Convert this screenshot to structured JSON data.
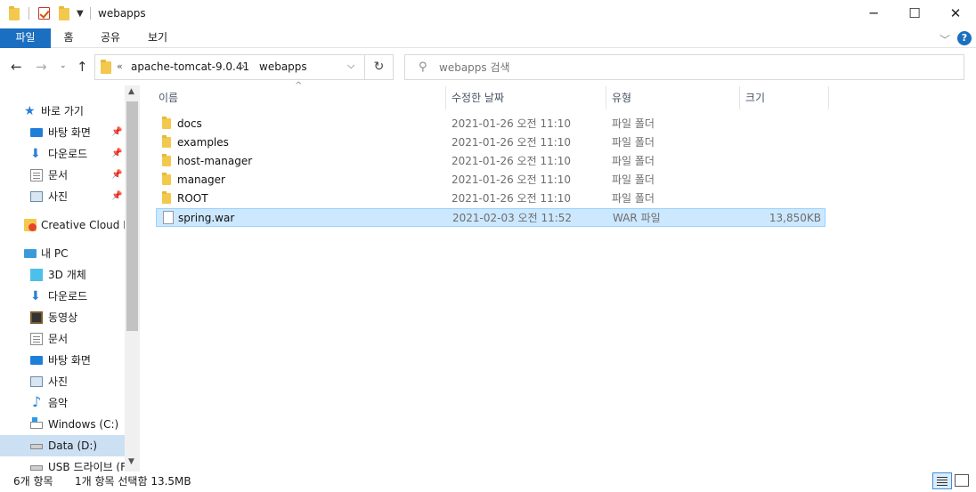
{
  "window": {
    "title": "webapps",
    "minimize": "─",
    "maximize": "☐",
    "close": "✕"
  },
  "ribbon": {
    "tabs": [
      {
        "label": "파일"
      },
      {
        "label": "홈"
      },
      {
        "label": "공유"
      },
      {
        "label": "보기"
      }
    ],
    "help": "?"
  },
  "address": {
    "overflow": "«",
    "crumbs": [
      "apache-tomcat-9.0.41",
      "webapps"
    ],
    "separator": "›"
  },
  "search": {
    "placeholder": "webapps 검색"
  },
  "nav": {
    "quick_access": "바로 가기",
    "items": [
      {
        "label": "바탕 화면",
        "icon": "desktop-icon",
        "pinned": true
      },
      {
        "label": "다운로드",
        "icon": "download-icon",
        "pinned": true
      },
      {
        "label": "문서",
        "icon": "document-icon",
        "pinned": true
      },
      {
        "label": "사진",
        "icon": "pictures-icon",
        "pinned": true
      }
    ],
    "creative_cloud": "Creative Cloud Fil",
    "this_pc": "내 PC",
    "pc_items": [
      {
        "label": "3D 개체",
        "icon": "3d-objects-icon"
      },
      {
        "label": "다운로드",
        "icon": "download-icon"
      },
      {
        "label": "동영상",
        "icon": "video-icon"
      },
      {
        "label": "문서",
        "icon": "document-icon"
      },
      {
        "label": "바탕 화면",
        "icon": "desktop-icon"
      },
      {
        "label": "사진",
        "icon": "pictures-icon"
      },
      {
        "label": "음악",
        "icon": "music-icon"
      },
      {
        "label": "Windows (C:)",
        "icon": "windows-drive-icon"
      },
      {
        "label": "Data (D:)",
        "icon": "drive-icon",
        "selected": true
      },
      {
        "label": "USB 드라이브 (F",
        "icon": "usb-drive-icon"
      }
    ]
  },
  "columns": {
    "name": "이름",
    "date": "수정한 날짜",
    "type": "유형",
    "size": "크기"
  },
  "files": [
    {
      "name": "docs",
      "date": "2021-01-26 오전 11:10",
      "type": "파일 폴더",
      "size": "",
      "kind": "folder"
    },
    {
      "name": "examples",
      "date": "2021-01-26 오전 11:10",
      "type": "파일 폴더",
      "size": "",
      "kind": "folder"
    },
    {
      "name": "host-manager",
      "date": "2021-01-26 오전 11:10",
      "type": "파일 폴더",
      "size": "",
      "kind": "folder"
    },
    {
      "name": "manager",
      "date": "2021-01-26 오전 11:10",
      "type": "파일 폴더",
      "size": "",
      "kind": "folder"
    },
    {
      "name": "ROOT",
      "date": "2021-01-26 오전 11:10",
      "type": "파일 폴더",
      "size": "",
      "kind": "folder"
    },
    {
      "name": "spring.war",
      "date": "2021-02-03 오전 11:52",
      "type": "WAR 파일",
      "size": "13,850KB",
      "kind": "file",
      "selected": true
    }
  ],
  "status": {
    "item_count": "6개 항목",
    "selection": "1개 항목 선택함 13.5MB"
  },
  "colors": {
    "accent": "#1a6fc0",
    "selection": "#cce8ff",
    "folder": "#f2c94c"
  }
}
